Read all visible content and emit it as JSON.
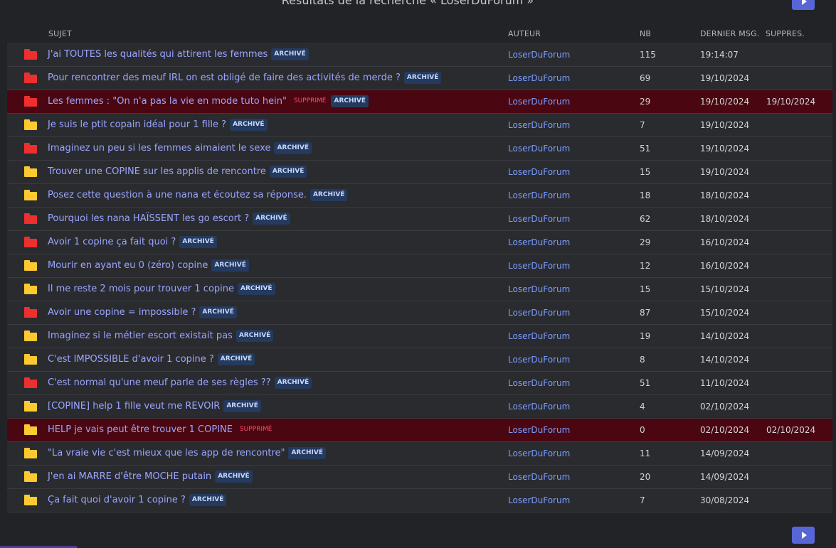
{
  "page": {
    "title": "Résultats de la recherche « LoserDuForum »"
  },
  "table": {
    "headers": {
      "subject": "SUJET",
      "author": "AUTEUR",
      "count": "NB",
      "last": "DERNIER MSG.",
      "deleted": "SUPPRES."
    },
    "rows": [
      {
        "color": "red",
        "subject": "J'ai TOUTES les qualités qui attirent les femmes",
        "badges": [
          "ARCHIVÉ"
        ],
        "author": "LoserDuForum",
        "count": "115",
        "last": "19:14:07",
        "deleted_date": "",
        "deleted": false
      },
      {
        "color": "red",
        "subject": "Pour rencontrer des meuf IRL on est obligé de faire des activités de merde ?",
        "badges": [
          "ARCHIVÉ"
        ],
        "author": "LoserDuForum",
        "count": "69",
        "last": "19/10/2024",
        "deleted_date": "",
        "deleted": false
      },
      {
        "color": "red",
        "subject": "Les femmes : \"On n'a pas la vie en mode tuto hein\"",
        "badges": [
          "SUPPRIMÉ",
          "ARCHIVÉ"
        ],
        "author": "LoserDuForum",
        "count": "29",
        "last": "19/10/2024",
        "deleted_date": "19/10/2024",
        "deleted": true
      },
      {
        "color": "yellow",
        "subject": "Je suis le ptit copain idéal pour 1 fille ?",
        "badges": [
          "ARCHIVÉ"
        ],
        "author": "LoserDuForum",
        "count": "7",
        "last": "19/10/2024",
        "deleted_date": "",
        "deleted": false
      },
      {
        "color": "red",
        "subject": "Imaginez un peu si les femmes aimaient le sexe",
        "badges": [
          "ARCHIVÉ"
        ],
        "author": "LoserDuForum",
        "count": "51",
        "last": "19/10/2024",
        "deleted_date": "",
        "deleted": false
      },
      {
        "color": "yellow",
        "subject": "Trouver une COPINE sur les applis de rencontre",
        "badges": [
          "ARCHIVÉ"
        ],
        "author": "LoserDuForum",
        "count": "15",
        "last": "19/10/2024",
        "deleted_date": "",
        "deleted": false
      },
      {
        "color": "yellow",
        "subject": "Posez cette question à une nana et écoutez sa réponse.",
        "badges": [
          "ARCHIVÉ"
        ],
        "author": "LoserDuForum",
        "count": "18",
        "last": "18/10/2024",
        "deleted_date": "",
        "deleted": false
      },
      {
        "color": "red",
        "subject": "Pourquoi les nana HAÏSSENT les go escort ?",
        "badges": [
          "ARCHIVÉ"
        ],
        "author": "LoserDuForum",
        "count": "62",
        "last": "18/10/2024",
        "deleted_date": "",
        "deleted": false
      },
      {
        "color": "red",
        "subject": "Avoir 1 copine ça fait quoi ?",
        "badges": [
          "ARCHIVÉ"
        ],
        "author": "LoserDuForum",
        "count": "29",
        "last": "16/10/2024",
        "deleted_date": "",
        "deleted": false
      },
      {
        "color": "yellow",
        "subject": "Mourir en ayant eu 0 (zéro) copine",
        "badges": [
          "ARCHIVÉ"
        ],
        "author": "LoserDuForum",
        "count": "12",
        "last": "16/10/2024",
        "deleted_date": "",
        "deleted": false
      },
      {
        "color": "yellow",
        "subject": "Il me reste 2 mois pour trouver 1 copine",
        "badges": [
          "ARCHIVÉ"
        ],
        "author": "LoserDuForum",
        "count": "15",
        "last": "15/10/2024",
        "deleted_date": "",
        "deleted": false
      },
      {
        "color": "red",
        "subject": "Avoir une copine = impossible ?",
        "badges": [
          "ARCHIVÉ"
        ],
        "author": "LoserDuForum",
        "count": "87",
        "last": "15/10/2024",
        "deleted_date": "",
        "deleted": false
      },
      {
        "color": "yellow",
        "subject": "Imaginez si le métier escort existait pas",
        "badges": [
          "ARCHIVÉ"
        ],
        "author": "LoserDuForum",
        "count": "19",
        "last": "14/10/2024",
        "deleted_date": "",
        "deleted": false
      },
      {
        "color": "yellow",
        "subject": "C'est IMPOSSIBLE d'avoir 1 copine ?",
        "badges": [
          "ARCHIVÉ"
        ],
        "author": "LoserDuForum",
        "count": "8",
        "last": "14/10/2024",
        "deleted_date": "",
        "deleted": false
      },
      {
        "color": "red",
        "subject": "C'est normal qu'une meuf parle de ses règles ??",
        "badges": [
          "ARCHIVÉ"
        ],
        "author": "LoserDuForum",
        "count": "51",
        "last": "11/10/2024",
        "deleted_date": "",
        "deleted": false
      },
      {
        "color": "yellow",
        "subject": "[COPINE] help 1 fille veut me REVOIR",
        "badges": [
          "ARCHIVÉ"
        ],
        "author": "LoserDuForum",
        "count": "4",
        "last": "02/10/2024",
        "deleted_date": "",
        "deleted": false
      },
      {
        "color": "yellow",
        "subject": "HELP je vais peut être trouver 1 COPINE",
        "badges": [
          "SUPPRIMÉ"
        ],
        "author": "LoserDuForum",
        "count": "0",
        "last": "02/10/2024",
        "deleted_date": "02/10/2024",
        "deleted": true
      },
      {
        "color": "yellow",
        "subject": "\"La vraie vie c'est mieux que les app de rencontre\"",
        "badges": [
          "ARCHIVÉ"
        ],
        "author": "LoserDuForum",
        "count": "11",
        "last": "14/09/2024",
        "deleted_date": "",
        "deleted": false
      },
      {
        "color": "yellow",
        "subject": "J'en ai MARRE d'être MOCHE putain",
        "badges": [
          "ARCHIVÉ"
        ],
        "author": "LoserDuForum",
        "count": "20",
        "last": "14/09/2024",
        "deleted_date": "",
        "deleted": false
      },
      {
        "color": "yellow",
        "subject": "Ça fait quoi d'avoir 1 copine ?",
        "badges": [
          "ARCHIVÉ"
        ],
        "author": "LoserDuForum",
        "count": "7",
        "last": "30/08/2024",
        "deleted_date": "",
        "deleted": false
      }
    ]
  },
  "colors": {
    "background": "#222326",
    "row": "#2a2b2f",
    "deleted_row": "#4a0711",
    "link": "#9aa5ff",
    "folder_red": "#ee2f2f",
    "folder_yellow": "#fdc930",
    "accent": "#5865d6"
  },
  "icons": {
    "pager_next": "triangle-right-icon",
    "folder": "folder-icon"
  }
}
